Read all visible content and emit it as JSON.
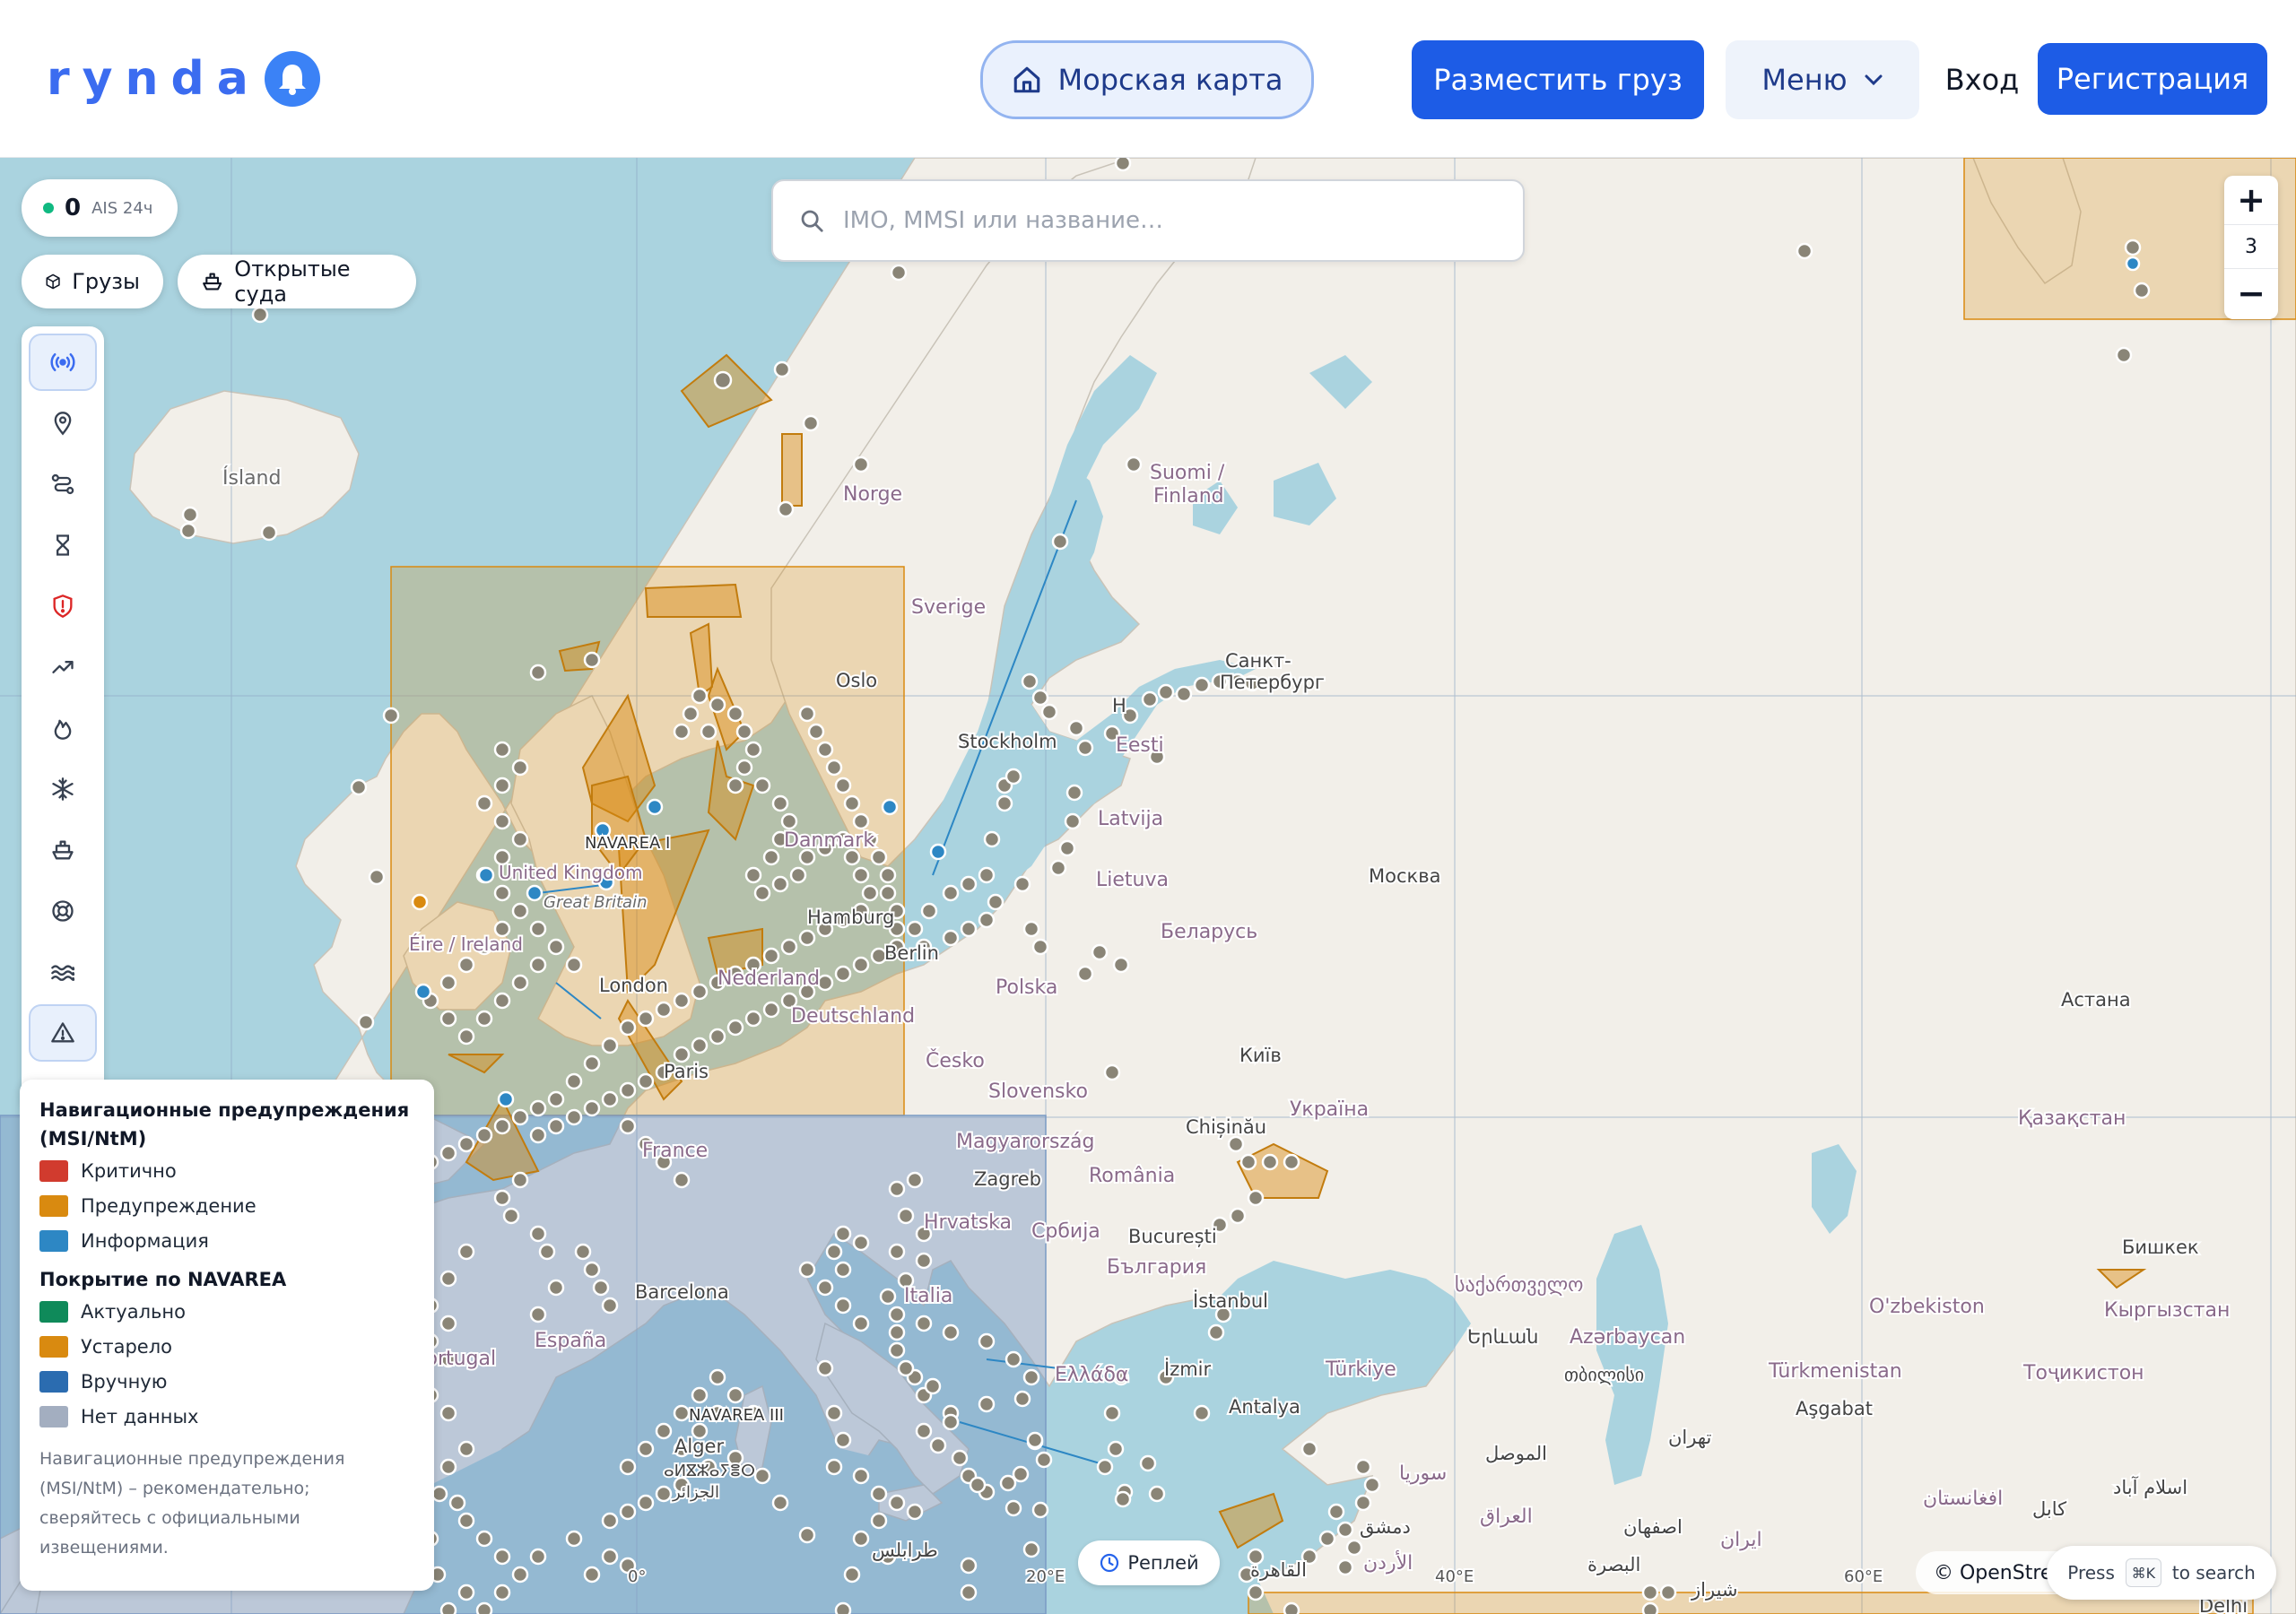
{
  "header": {
    "logo": "rynda",
    "sea_map": "Морская карта",
    "post_cargo": "Разместить груз",
    "menu": "Меню",
    "login": "Вход",
    "register": "Регистрация"
  },
  "ais": {
    "count": "0",
    "label": "AIS 24ч"
  },
  "chips": {
    "cargo": "Грузы",
    "vessels": "Открытые суда"
  },
  "search": {
    "placeholder": "IMO, MMSI или название…"
  },
  "zoom": {
    "in": "+",
    "level": "3",
    "out": "−"
  },
  "toolbar": {
    "icons": [
      "ais-signal-icon",
      "pin-icon",
      "route-icon",
      "hourglass-icon",
      "shield-alert-icon",
      "trend-icon",
      "fire-icon",
      "snowflake-icon",
      "ship-icon",
      "lifebuoy-icon",
      "waves-icon",
      "warning-triangle-icon"
    ]
  },
  "legend": {
    "title1": "Навигационные предупреждения (MSI/NtM)",
    "items1": [
      {
        "label": "Критично",
        "color": "#d13b2e"
      },
      {
        "label": "Предупреждение",
        "color": "#d98a10"
      },
      {
        "label": "Информация",
        "color": "#2d87c4"
      }
    ],
    "title2": "Покрытие по NAVAREA",
    "items2": [
      {
        "label": "Актуально",
        "color": "#0f8a5a"
      },
      {
        "label": "Устарело",
        "color": "#d98a10"
      },
      {
        "label": "Вручную",
        "color": "#2b6cb0"
      },
      {
        "label": "Нет данных",
        "color": "#a3aec0"
      }
    ],
    "note": "Навигационные предупреждения (MSI/NtM) – рекомендательно; сверяйтесь с официальными извещениями."
  },
  "replay": "Реплей",
  "attribution": "© OpenStreetMap",
  "search_hint": {
    "press": "Press",
    "key": "⌘K",
    "text": "to search"
  },
  "map": {
    "labels": {
      "island": "Ísland",
      "norge": "Norge",
      "sverige": "Sverige",
      "suomi": "Suomi /",
      "finland": "Finland",
      "oslo": "Oslo",
      "stockholm": "Stockholm",
      "helsinki": "H",
      "spb1": "Санкт-",
      "spb2": "Петербург",
      "eesti": "Eesti",
      "latvija": "Latvija",
      "lietuva": "Lietuva",
      "moskva": "Москва",
      "belarus": "Беларусь",
      "navarea1": "NAVAREA I",
      "uk": "United Kingdom",
      "gb": "Great Britain",
      "ireland": "Éire / Ireland",
      "london": "London",
      "nederland": "Nederland",
      "danmark": "Danmark",
      "hamburg": "Hamburg",
      "berlin": "Berlin",
      "polska": "Polska",
      "deutschland": "Deutschland",
      "paris": "Paris",
      "cesko": "Česko",
      "slovensko": "Slovensko",
      "kyiv": "Київ",
      "ukraina": "Україна",
      "chisinau": "Chișinău",
      "astana": "Астана",
      "kazakhstan": "Қазақстан",
      "france": "France",
      "magyar": "Magyarország",
      "zagreb": "Zagreb",
      "romania": "România",
      "hrvatska": "Hrvatska",
      "srbija": "Србија",
      "bucuresti": "București",
      "bulgaria": "България",
      "barcelona": "Barcelona",
      "italia": "Italia",
      "espana": "España",
      "portugal": "Portugal",
      "istanbul": "İstanbul",
      "sakartvelo": "საქართველო",
      "ozbekiston": "O'zbekiston",
      "kyrgyzstan": "Кыргызстан",
      "bishkek": "Бишкек",
      "yerevan": "Երևան",
      "azerbaycan": "Azərbaycan",
      "tbilisi": "თბილისი",
      "ellada": "Ελλάδα",
      "izmir": "İzmir",
      "turkiye": "Türkiye",
      "turkmenistan": "Türkmenistan",
      "tojikiston": "Тоҷикистон",
      "ashgabat": "Aşgabat",
      "navarea3": "NAVAREA III",
      "alger1": "Alger",
      "alger2": "ⴰⵍⴵⵣⴰⵢⴻⵔ",
      "alger3": "الجزائر",
      "antalya": "Antalya",
      "tehran": "تهران",
      "mosul": "الموصل",
      "syria": "سوريا",
      "iraq": "العراق",
      "isfahan": "اصفهان",
      "iran": "ایران",
      "afghanistan": "افغانستان",
      "kabul": "کابل",
      "islamabad": "اسلام آباد",
      "tarabulus": "طرابلس",
      "dimashq": "دمشق",
      "urdun": "الأردن",
      "qahira": "القاهرة",
      "basra": "البصرة",
      "shiraz": "شیراز",
      "delhi": "Delhi",
      "lon0": "0°",
      "lon20": "20°E",
      "lon40": "40°E",
      "lon60": "60°E"
    }
  }
}
